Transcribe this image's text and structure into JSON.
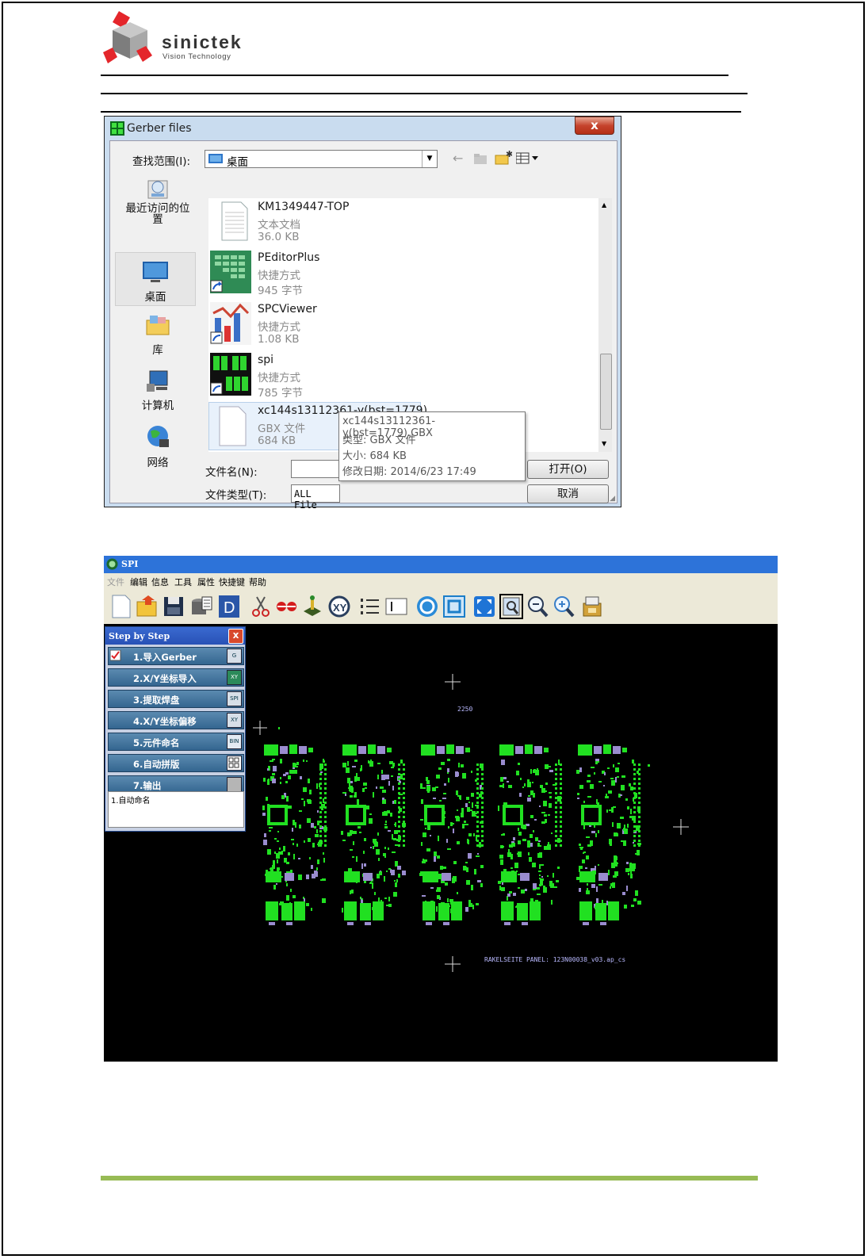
{
  "logo": {
    "brand": "sinictek",
    "tagline": "Vision Technology"
  },
  "dialog": {
    "title": "Gerber files",
    "close_glyph": "x",
    "look_in_label": "查找范围(I):",
    "look_in_value": "桌面",
    "places": [
      "最近访问的位置",
      "桌面",
      "库",
      "计算机",
      "网络"
    ],
    "files": [
      {
        "name": "KM1349447-TOP",
        "type": "文本文档",
        "size": "36.0 KB"
      },
      {
        "name": "PEditorPlus",
        "type": "快捷方式",
        "size": "945 字节"
      },
      {
        "name": "SPCViewer",
        "type": "快捷方式",
        "size": "1.08 KB"
      },
      {
        "name": "spi",
        "type": "快捷方式",
        "size": "785 字节"
      },
      {
        "name": "xc144s13112361-y(bst=1779)...",
        "type": "GBX 文件",
        "size": "684 KB"
      }
    ],
    "tooltip": {
      "line1": "xc144s13112361-y(bst=1779).GBX",
      "line2": "类型: GBX 文件",
      "line3": "大小: 684 KB",
      "line4": "修改日期: 2014/6/23 17:49"
    },
    "filename_label": "文件名(N):",
    "filename_value": "",
    "filetype_label": "文件类型(T):",
    "filetype_value": "ALL File",
    "open_button": "打开(O)",
    "cancel_button": "取消"
  },
  "spi": {
    "title": "SPI",
    "menu": [
      "文件",
      "编辑",
      "信息",
      "工具",
      "属性",
      "快捷键",
      "帮助"
    ],
    "toolbar_icons": [
      "new-icon",
      "open-folder-icon",
      "save-icon",
      "database-icon",
      "d-icon",
      "scissors-icon",
      "connect-icon",
      "joystick-icon",
      "xy-icon",
      "list-icon",
      "textbox-icon",
      "rotate-icon",
      "frame-icon",
      "fit-icon",
      "zoom-window-icon",
      "zoom-out-icon",
      "zoom-in-icon",
      "export-icon"
    ],
    "panel": {
      "title": "Step by Step",
      "close_glyph": "x",
      "steps": [
        {
          "label": "1.导入Gerber",
          "icon": "G",
          "checked": true
        },
        {
          "label": "2.X/Y坐标导入",
          "icon": "XY",
          "checked": false
        },
        {
          "label": "3.提取焊盘",
          "icon": "SPI",
          "checked": false
        },
        {
          "label": "4.X/Y坐标偏移",
          "icon": "XY",
          "checked": false
        },
        {
          "label": "5.元件命名",
          "icon": "BIN",
          "checked": false
        },
        {
          "label": "6.自动拼版",
          "icon": "",
          "checked": false
        },
        {
          "label": "7.输出",
          "icon": "",
          "checked": false
        }
      ],
      "note": "1.自动命名"
    },
    "canvas": {
      "top_label": "2250",
      "bottom_label": "RAKELSEITE PANEL: 123N00038_v03.ap_cs",
      "board_count": 5,
      "pad_color": "#21e021"
    }
  },
  "footer": {
    "bar_color": "#97bb55"
  }
}
